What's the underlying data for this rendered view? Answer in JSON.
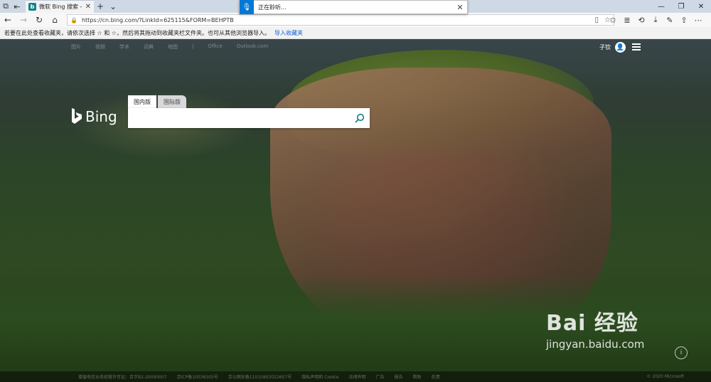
{
  "browser": {
    "tab": {
      "title": "微软 Bing 搜索 - 国内版"
    },
    "url": "https://cn.bing.com/?LinkId=625115&FORM=BEHPTB",
    "favorites_bar": {
      "message": "若要在此处查看收藏夹，请依次选择 ☆ 和 ☆，然后将其拖动到收藏夹栏文件夹。也可从其他浏览器导入。",
      "import_link": "导入收藏夹"
    },
    "voice_popup": {
      "text": "正在聆听..."
    }
  },
  "bing": {
    "nav": [
      "图片",
      "视频",
      "学术",
      "词典",
      "地图",
      "|",
      "Office",
      "Outlook.com"
    ],
    "user_name": "子钦",
    "logo_text": "Bing",
    "search_tabs": [
      "国内版",
      "国际版"
    ],
    "search_value": "",
    "footer": {
      "links": [
        "增值电信业务经营许可证：合字B2-20090007",
        "京ICP备10036305号",
        "京公网安备11010802022657号",
        "隐私声明和 Cookie",
        "法律声明",
        "广告",
        "报告",
        "帮助",
        "反馈"
      ],
      "copyright": "© 2020 Microsoft"
    }
  },
  "watermark": {
    "main": "Bai 经验",
    "url": "jingyan.baidu.com"
  },
  "colors": {
    "accent": "#0078d4",
    "bing_teal": "#0f8387"
  }
}
